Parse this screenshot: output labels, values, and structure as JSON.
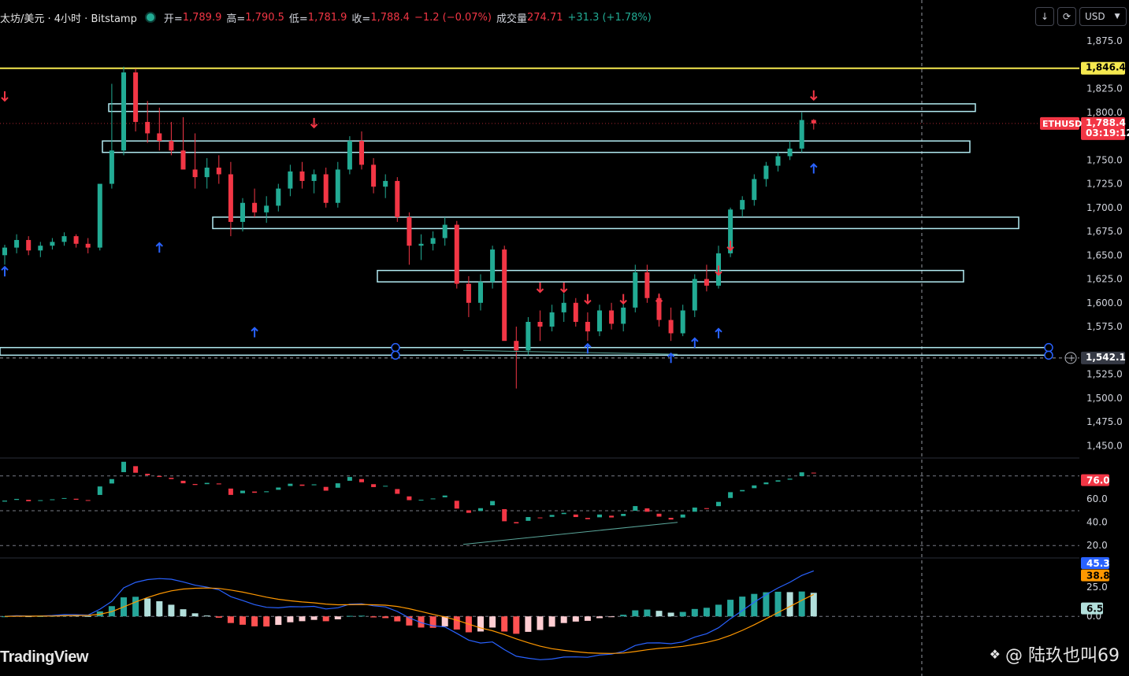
{
  "header": {
    "symbol": "太坊/美元 · 4小时 · Bitstamp",
    "open_label": "开=",
    "open": "1,789.9",
    "high_label": "高=",
    "high": "1,790.5",
    "low_label": "低=",
    "low": "1,781.9",
    "close_label": "收=",
    "close": "1,788.4",
    "change": "−1.2 (−0.07%)",
    "volume_label": "成交量",
    "volume": "274.71",
    "volume_change": "+31.3 (+1.78%)"
  },
  "toolbar": {
    "down_icon": "arrow-down-icon",
    "refresh_icon": "refresh-icon",
    "currency": "USD"
  },
  "watermark": {
    "brand": "TradingView",
    "author": "@ 陆玖也叫69"
  },
  "chart_data": {
    "type": "candlestick",
    "symbol_tag": "ETHUSD",
    "last_price": "1,788.4",
    "countdown": "03:19:12",
    "resistance_label": "1,846.4",
    "support_label": "1,542.1",
    "price_axis": {
      "ylim": [
        1437,
        1885
      ],
      "ticks": [
        "1,875.0",
        "1,825.0",
        "1,800.0",
        "1,750.0",
        "1,725.0",
        "1,700.0",
        "1,675.0",
        "1,650.0",
        "1,625.0",
        "1,600.0",
        "1,575.0",
        "1,525.0",
        "1,500.0",
        "1,475.0",
        "1,450.0"
      ],
      "tick_values": [
        1875,
        1825,
        1800,
        1750,
        1725,
        1700,
        1675,
        1650,
        1625,
        1600,
        1575,
        1525,
        1500,
        1475,
        1450
      ]
    },
    "horizontal_line": 1846.4,
    "zones": [
      [
        1801,
        1809
      ],
      [
        1758,
        1770
      ],
      [
        1678,
        1690
      ],
      [
        1622,
        1634
      ],
      [
        1545,
        1553
      ]
    ],
    "sell_arrows": [
      [
        0,
        1809
      ],
      [
        26,
        1781
      ],
      [
        45,
        1608
      ],
      [
        47,
        1608
      ],
      [
        49,
        1596
      ],
      [
        52,
        1596
      ],
      [
        55,
        1596
      ],
      [
        60,
        1626
      ],
      [
        61,
        1652
      ],
      [
        68,
        1810
      ]
    ],
    "buy_arrows": [
      [
        13,
        1666
      ],
      [
        21,
        1577
      ],
      [
        49,
        1560
      ],
      [
        56,
        1550
      ],
      [
        58,
        1566
      ],
      [
        60,
        1576
      ],
      [
        68,
        1749
      ],
      [
        -0.5,
        1641
      ]
    ],
    "candles": [
      [
        1650,
        1661,
        1640,
        1658
      ],
      [
        1658,
        1672,
        1652,
        1666
      ],
      [
        1666,
        1670,
        1650,
        1655
      ],
      [
        1655,
        1664,
        1648,
        1660
      ],
      [
        1660,
        1668,
        1656,
        1664
      ],
      [
        1664,
        1674,
        1660,
        1670
      ],
      [
        1670,
        1672,
        1658,
        1662
      ],
      [
        1662,
        1668,
        1652,
        1658
      ],
      [
        1658,
        1702,
        1655,
        1725
      ],
      [
        1725,
        1830,
        1720,
        1760
      ],
      [
        1760,
        1848,
        1755,
        1842
      ],
      [
        1842,
        1846,
        1780,
        1790
      ],
      [
        1790,
        1812,
        1768,
        1778
      ],
      [
        1778,
        1805,
        1760,
        1770
      ],
      [
        1770,
        1790,
        1755,
        1760
      ],
      [
        1760,
        1795,
        1748,
        1740
      ],
      [
        1740,
        1778,
        1720,
        1732
      ],
      [
        1732,
        1752,
        1720,
        1742
      ],
      [
        1742,
        1755,
        1725,
        1735
      ],
      [
        1735,
        1748,
        1670,
        1685
      ],
      [
        1685,
        1710,
        1675,
        1705
      ],
      [
        1705,
        1720,
        1690,
        1695
      ],
      [
        1695,
        1712,
        1684,
        1702
      ],
      [
        1702,
        1725,
        1696,
        1720
      ],
      [
        1720,
        1745,
        1712,
        1738
      ],
      [
        1738,
        1748,
        1720,
        1728
      ],
      [
        1728,
        1740,
        1715,
        1735
      ],
      [
        1735,
        1742,
        1700,
        1705
      ],
      [
        1705,
        1748,
        1700,
        1740
      ],
      [
        1740,
        1775,
        1735,
        1770
      ],
      [
        1770,
        1780,
        1740,
        1745
      ],
      [
        1745,
        1752,
        1715,
        1722
      ],
      [
        1722,
        1735,
        1710,
        1728
      ],
      [
        1728,
        1732,
        1685,
        1690
      ],
      [
        1690,
        1695,
        1640,
        1660
      ],
      [
        1660,
        1672,
        1645,
        1662
      ],
      [
        1662,
        1675,
        1655,
        1668
      ],
      [
        1668,
        1690,
        1660,
        1682
      ],
      [
        1682,
        1686,
        1615,
        1620
      ],
      [
        1620,
        1628,
        1585,
        1600
      ],
      [
        1600,
        1630,
        1592,
        1622
      ],
      [
        1622,
        1660,
        1615,
        1656
      ],
      [
        1656,
        1660,
        1600,
        1560
      ],
      [
        1560,
        1575,
        1510,
        1550
      ],
      [
        1550,
        1585,
        1545,
        1580
      ],
      [
        1580,
        1592,
        1560,
        1575
      ],
      [
        1575,
        1598,
        1570,
        1590
      ],
      [
        1590,
        1610,
        1580,
        1600
      ],
      [
        1600,
        1605,
        1575,
        1580
      ],
      [
        1580,
        1590,
        1560,
        1570
      ],
      [
        1570,
        1598,
        1565,
        1592
      ],
      [
        1592,
        1600,
        1572,
        1578
      ],
      [
        1578,
        1600,
        1570,
        1595
      ],
      [
        1595,
        1640,
        1590,
        1632
      ],
      [
        1632,
        1640,
        1600,
        1605
      ],
      [
        1605,
        1610,
        1575,
        1582
      ],
      [
        1582,
        1595,
        1560,
        1568
      ],
      [
        1568,
        1598,
        1565,
        1592
      ],
      [
        1592,
        1630,
        1585,
        1625
      ],
      [
        1625,
        1640,
        1612,
        1618
      ],
      [
        1618,
        1660,
        1615,
        1652
      ],
      [
        1652,
        1700,
        1648,
        1698
      ],
      [
        1698,
        1712,
        1690,
        1708
      ],
      [
        1708,
        1735,
        1702,
        1730
      ],
      [
        1730,
        1748,
        1722,
        1744
      ],
      [
        1744,
        1758,
        1738,
        1754
      ],
      [
        1754,
        1770,
        1750,
        1762
      ],
      [
        1762,
        1800,
        1758,
        1792
      ],
      [
        1792,
        1793,
        1782,
        1788.4
      ]
    ],
    "rsi_panel": {
      "ticks": [
        "60.0",
        "40.0",
        "20.0"
      ],
      "tick_values": [
        60,
        40,
        20
      ],
      "ylim": [
        12,
        90
      ],
      "levels": [
        80,
        50,
        20
      ],
      "last_value": "76.0"
    },
    "macd_panel": {
      "ticks": [
        "25.0",
        "0.0"
      ],
      "tick_values": [
        25,
        0
      ],
      "ylim": [
        -45,
        48
      ],
      "macd_value": "45.3",
      "signal_value": "38.8",
      "hist_value": "6.5"
    }
  }
}
